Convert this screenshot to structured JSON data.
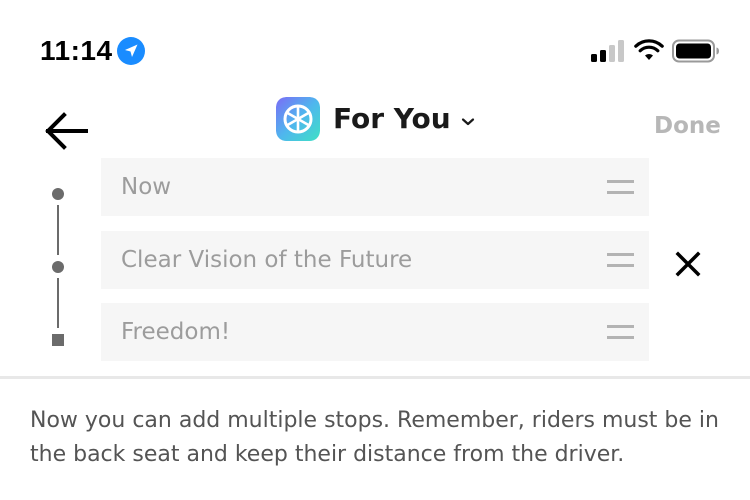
{
  "status_bar": {
    "time": "11:14",
    "icons": [
      "location-arrow-icon",
      "cellular-signal-icon",
      "wifi-icon",
      "battery-icon"
    ]
  },
  "header": {
    "back_icon": "arrow-left-icon",
    "app_logo": "for-you-logo",
    "title": "For You",
    "title_dropdown_icon": "chevron-down-icon",
    "done_label": "Done"
  },
  "stops": [
    {
      "placeholder": "Now",
      "handle_icon": "drag-handle-icon"
    },
    {
      "placeholder": "Clear Vision of the Future",
      "handle_icon": "drag-handle-icon"
    },
    {
      "placeholder": "Freedom!",
      "handle_icon": "drag-handle-icon"
    }
  ],
  "remove_icon": "close-icon",
  "info_text": "Now you can add multiple stops. Remember, riders must be in the back seat and keep their distance from the driver.",
  "colors": {
    "location_accent": "#1a8cff",
    "logo_gradient_start": "#7b6cf6",
    "logo_gradient_end": "#3fe0c5",
    "field_background": "#f6f6f6",
    "placeholder_text": "#9c9c9c",
    "done_text": "#b7b7b7",
    "body_text": "#545454"
  }
}
